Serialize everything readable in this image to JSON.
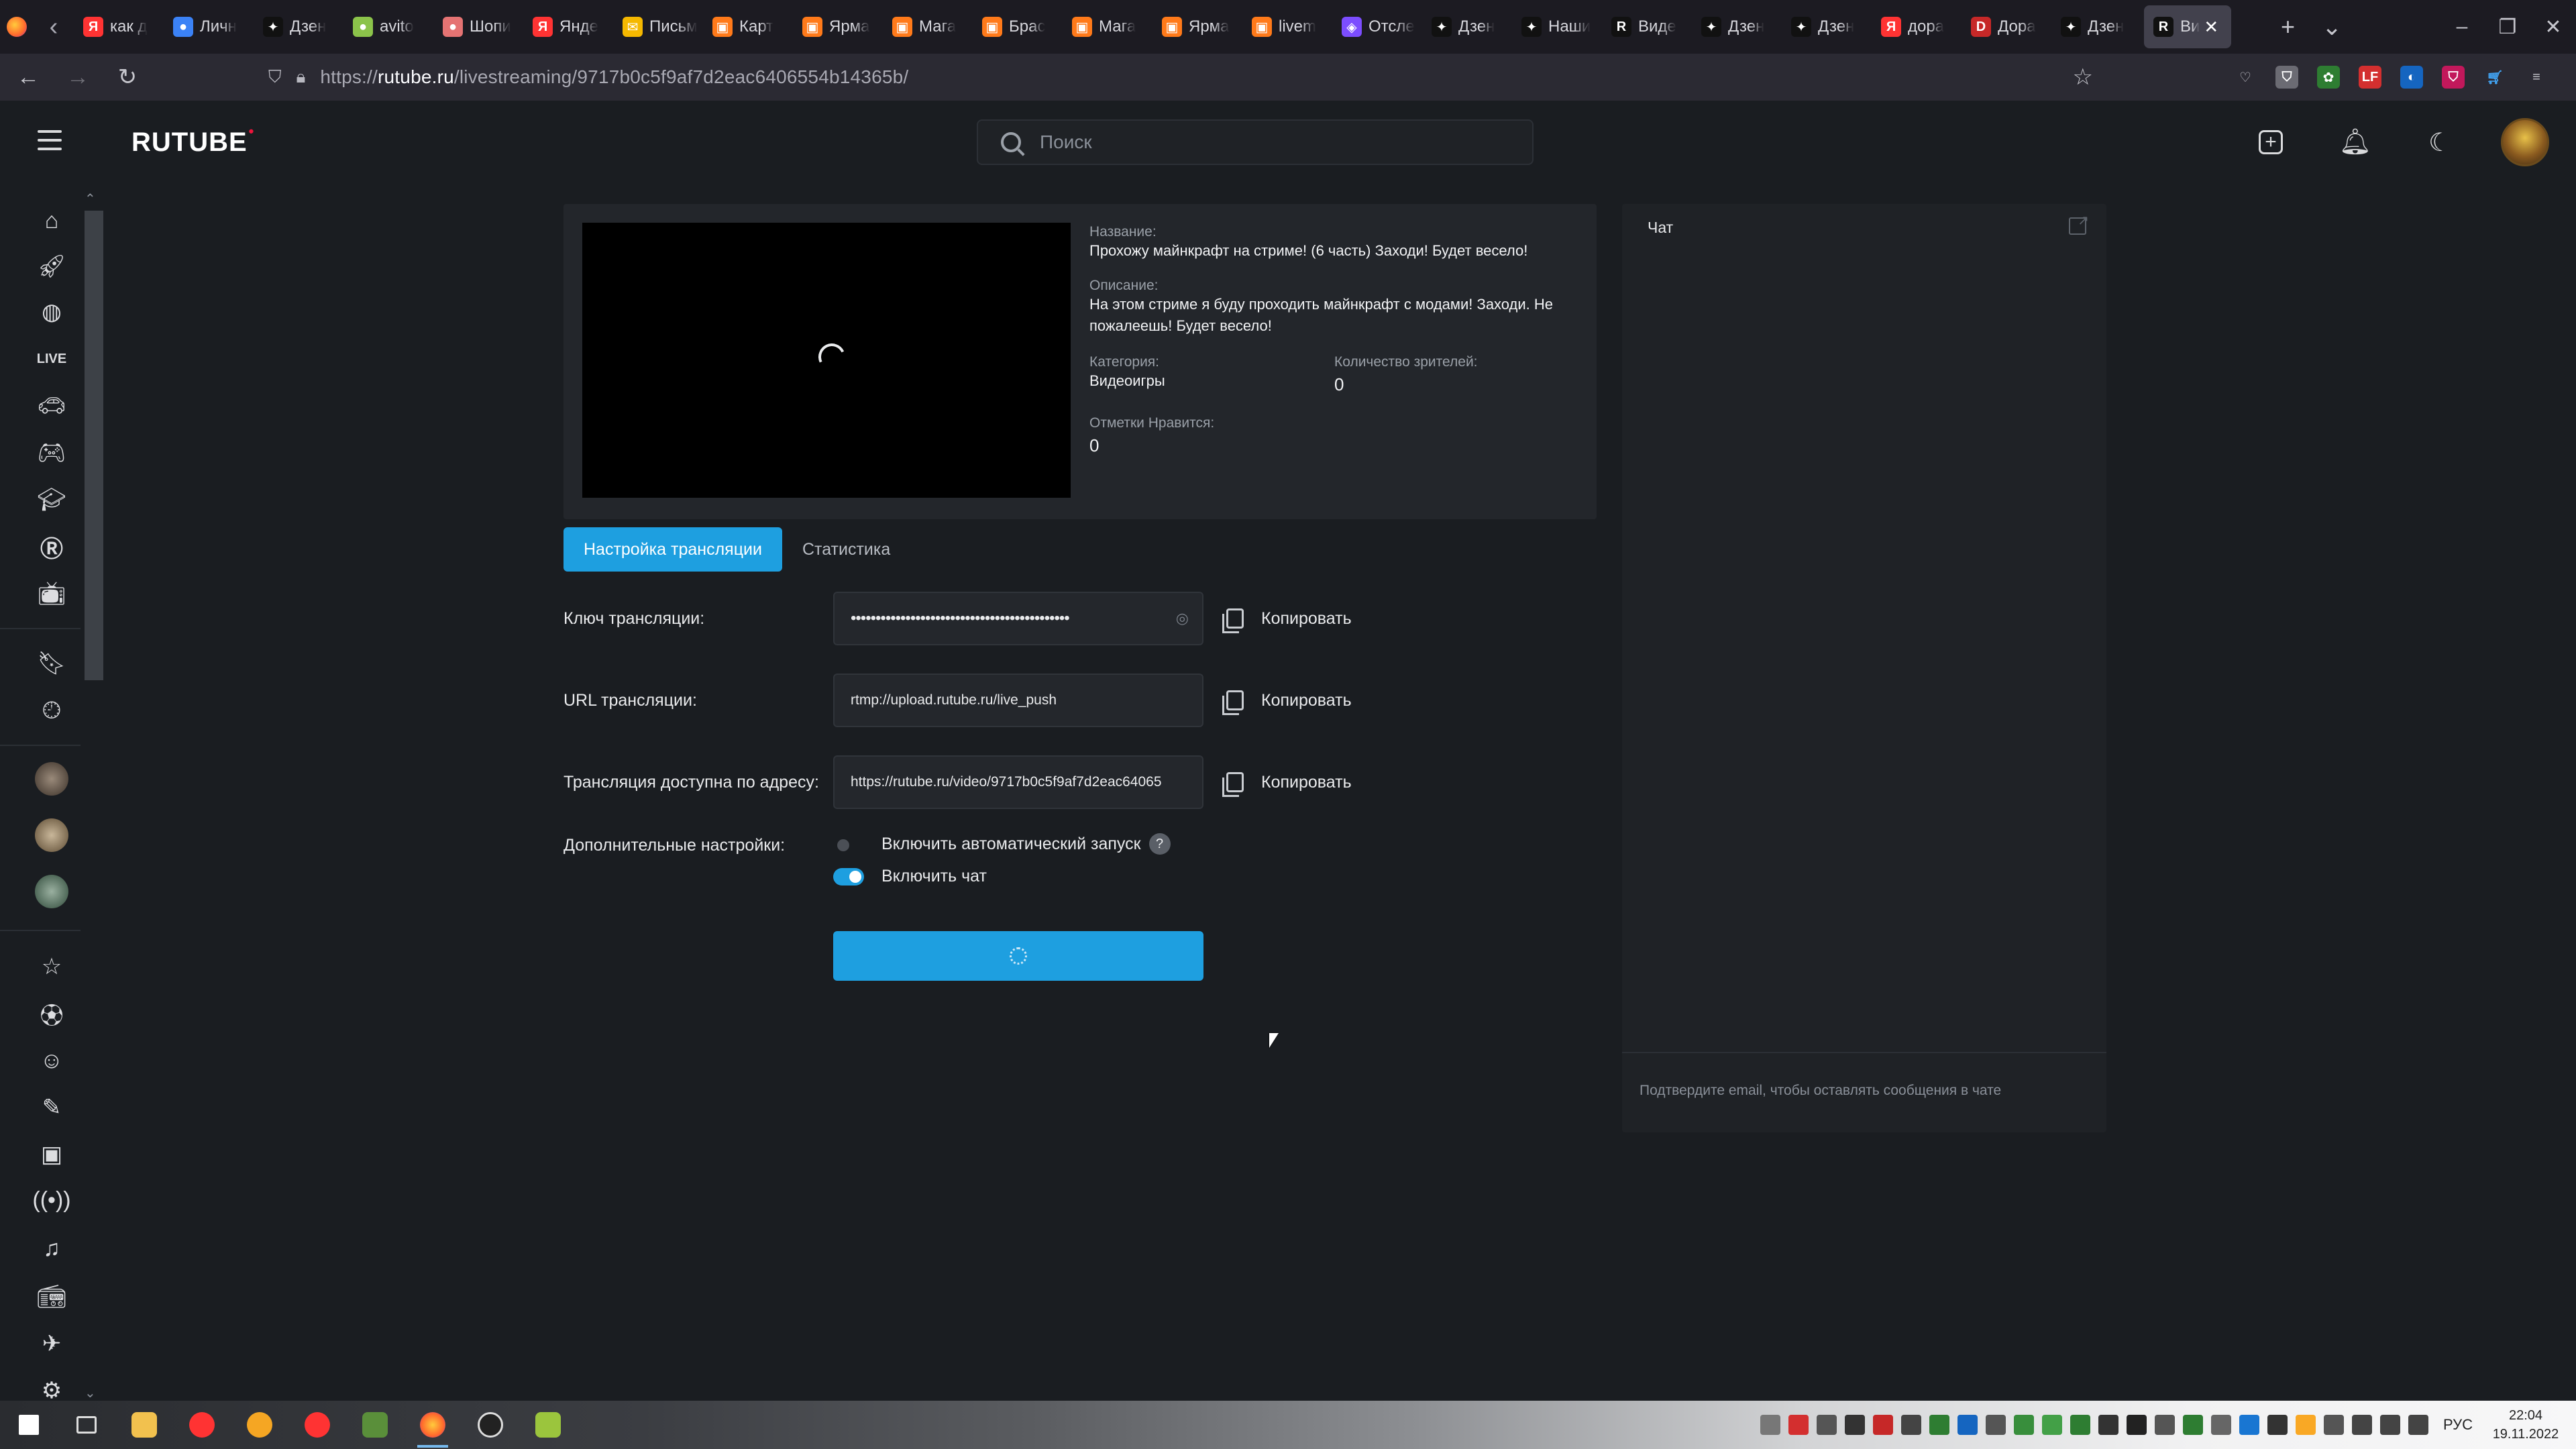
{
  "browser": {
    "tabs": [
      {
        "title": "как д",
        "favicon_color": "#ff3333",
        "glyph": "Я"
      },
      {
        "title": "Личн",
        "favicon_color": "#3b82f6",
        "glyph": "●"
      },
      {
        "title": "Дзен",
        "favicon_color": "#111111",
        "glyph": "✦"
      },
      {
        "title": "avito",
        "favicon_color": "#8bc34a",
        "glyph": "●"
      },
      {
        "title": "Шопи",
        "favicon_color": "#e57373",
        "glyph": "●"
      },
      {
        "title": "Янде",
        "favicon_color": "#ff3333",
        "glyph": "Я"
      },
      {
        "title": "Письм",
        "favicon_color": "#f5b800",
        "glyph": "✉"
      },
      {
        "title": "Карт",
        "favicon_color": "#ff7a1a",
        "glyph": "▣"
      },
      {
        "title": "Ярма",
        "favicon_color": "#ff7a1a",
        "glyph": "▣"
      },
      {
        "title": "Мага",
        "favicon_color": "#ff7a1a",
        "glyph": "▣"
      },
      {
        "title": "Брас",
        "favicon_color": "#ff7a1a",
        "glyph": "▣"
      },
      {
        "title": "Мага",
        "favicon_color": "#ff7a1a",
        "glyph": "▣"
      },
      {
        "title": "Ярма",
        "favicon_color": "#ff7a1a",
        "glyph": "▣"
      },
      {
        "title": "livem",
        "favicon_color": "#ff7a1a",
        "glyph": "▣"
      },
      {
        "title": "Отсле",
        "favicon_color": "#7c4dff",
        "glyph": "◈"
      },
      {
        "title": "Дзен",
        "favicon_color": "#111111",
        "glyph": "✦"
      },
      {
        "title": "Наши",
        "favicon_color": "#111111",
        "glyph": "✦"
      },
      {
        "title": "Виде",
        "favicon_color": "#111111",
        "glyph": "R"
      },
      {
        "title": "Дзен",
        "favicon_color": "#111111",
        "glyph": "✦"
      },
      {
        "title": "Дзен",
        "favicon_color": "#111111",
        "glyph": "✦"
      },
      {
        "title": "дора",
        "favicon_color": "#ff3333",
        "glyph": "Я"
      },
      {
        "title": "Дора",
        "favicon_color": "#c62828",
        "glyph": "D"
      },
      {
        "title": "Дзен",
        "favicon_color": "#111111",
        "glyph": "✦"
      }
    ],
    "active_tab": {
      "title": "Ви",
      "glyph": "R"
    },
    "url_prefix": "https://",
    "url_host": "rutube.ru",
    "url_path": "/livestreaming/9717b0c5f9af7d2eac6406554b14365b/"
  },
  "site": {
    "logo": "RUTUBE",
    "search_placeholder": "Поиск"
  },
  "stream": {
    "name_label": "Название:",
    "name_value": "Прохожу майнкрафт на стриме! (6 часть) Заходи! Будет весело!",
    "desc_label": "Описание:",
    "desc_value": "На этом стриме я буду проходить майнкрафт с модами! Заходи. Не пожалеешь! Будет весело!",
    "category_label": "Категория:",
    "category_value": "Видеоигры",
    "viewers_label": "Количество зрителей:",
    "viewers_value": "0",
    "likes_label": "Отметки Нравится:",
    "likes_value": "0"
  },
  "tabs": {
    "settings": "Настройка трансляции",
    "stats": "Статистика"
  },
  "settings": {
    "key_label": "Ключ трансляции:",
    "key_value": "••••••••••••••••••••••••••••••••••••••••••••",
    "url_label": "URL трансляции:",
    "url_value": "rtmp://upload.rutube.ru/live_push",
    "public_label": "Трансляция доступна по адресу:",
    "public_value": "https://rutube.ru/video/9717b0c5f9af7d2eac64065",
    "copy": "Копировать",
    "extra_label": "Дополнительные настройки:",
    "autostart_label": "Включить автоматический запуск",
    "autostart_enabled": false,
    "chat_label": "Включить чат",
    "chat_enabled": true,
    "help_glyph": "?"
  },
  "chat": {
    "title": "Чат",
    "note": "Подтвердите email, чтобы оставлять сообщения в чате"
  },
  "taskbar": {
    "lang": "РУС",
    "time": "22:04",
    "date": "19.11.2022"
  }
}
